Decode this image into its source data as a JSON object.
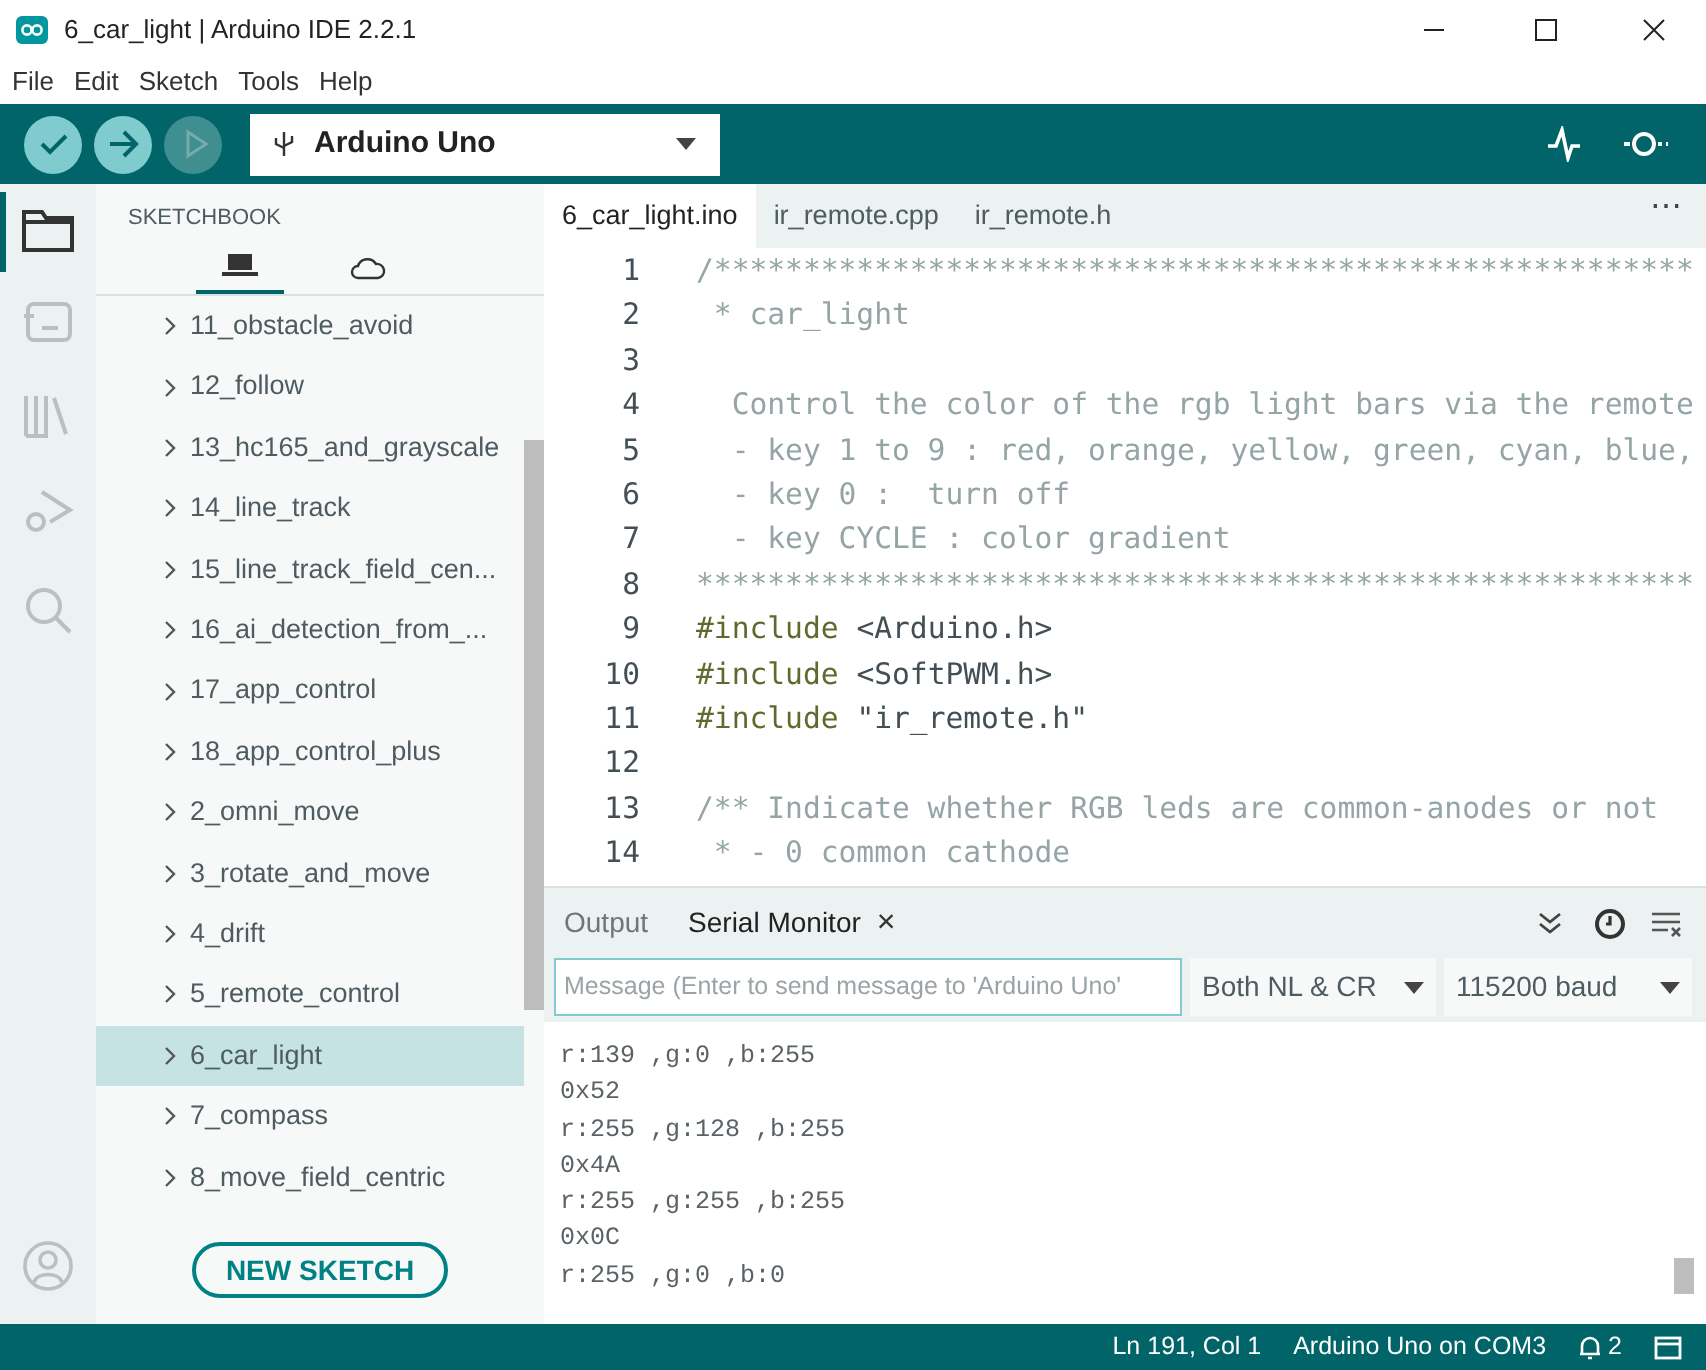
{
  "window": {
    "title": "6_car_light | Arduino IDE 2.2.1"
  },
  "menu": [
    "File",
    "Edit",
    "Sketch",
    "Tools",
    "Help"
  ],
  "toolbar": {
    "board": "Arduino Uno"
  },
  "sidebar": {
    "title": "SKETCHBOOK",
    "tabs": [
      {
        "kind": "local",
        "selected": true
      },
      {
        "kind": "cloud",
        "selected": false
      }
    ],
    "items": [
      {
        "label": "11_obstacle_avoid",
        "selected": false
      },
      {
        "label": "12_follow",
        "selected": false
      },
      {
        "label": "13_hc165_and_grayscale",
        "selected": false
      },
      {
        "label": "14_line_track",
        "selected": false
      },
      {
        "label": "15_line_track_field_cen...",
        "selected": false
      },
      {
        "label": "16_ai_detection_from_...",
        "selected": false
      },
      {
        "label": "17_app_control",
        "selected": false
      },
      {
        "label": "18_app_control_plus",
        "selected": false
      },
      {
        "label": "2_omni_move",
        "selected": false
      },
      {
        "label": "3_rotate_and_move",
        "selected": false
      },
      {
        "label": "4_drift",
        "selected": false
      },
      {
        "label": "5_remote_control",
        "selected": false
      },
      {
        "label": "6_car_light",
        "selected": true
      },
      {
        "label": "7_compass",
        "selected": false
      },
      {
        "label": "8_move_field_centric",
        "selected": false
      }
    ],
    "button": "NEW SKETCH"
  },
  "editor": {
    "more": "⋯",
    "tabs": [
      {
        "label": "6_car_light.ino",
        "selected": true
      },
      {
        "label": "ir_remote.cpp",
        "selected": false
      },
      {
        "label": "ir_remote.h",
        "selected": false
      }
    ],
    "lines": [
      {
        "number": "1",
        "segments": [
          {
            "text": "/*******************************************************",
            "kind": "comment"
          }
        ]
      },
      {
        "number": "2",
        "segments": [
          {
            "text": " * car_light",
            "kind": "comment"
          }
        ]
      },
      {
        "number": "3"
      },
      {
        "number": "4",
        "segments": [
          {
            "text": "  Control the color of the rgb light bars via the remote",
            "kind": "comment"
          }
        ]
      },
      {
        "number": "5",
        "segments": [
          {
            "text": "  - key 1 to 9 : red, orange, yellow, green, cyan, blue,",
            "kind": "comment"
          }
        ]
      },
      {
        "number": "6",
        "segments": [
          {
            "text": "  - key 0 :  turn off",
            "kind": "comment"
          }
        ]
      },
      {
        "number": "7",
        "segments": [
          {
            "text": "  - key CYCLE : color gradient",
            "kind": "comment"
          }
        ]
      },
      {
        "number": "8",
        "segments": [
          {
            "text": "********************************************************",
            "kind": "comment"
          }
        ]
      },
      {
        "number": "9",
        "segments": [
          {
            "text": "#include",
            "kind": "directive"
          },
          {
            "text": " <Arduino.h>",
            "kind": "code"
          }
        ]
      },
      {
        "number": "10",
        "segments": [
          {
            "text": "#include",
            "kind": "directive"
          },
          {
            "text": " <SoftPWM.h>",
            "kind": "code"
          }
        ]
      },
      {
        "number": "11",
        "segments": [
          {
            "text": "#include",
            "kind": "directive"
          },
          {
            "text": " \"ir_remote.h\"",
            "kind": "code"
          }
        ]
      },
      {
        "number": "12"
      },
      {
        "number": "13",
        "segments": [
          {
            "text": "/** Indicate whether RGB leds are common-anodes or not",
            "kind": "comment"
          }
        ]
      },
      {
        "number": "14",
        "segments": [
          {
            "text": " * - 0 common cathode",
            "kind": "comment"
          }
        ]
      }
    ]
  },
  "panel": {
    "tabs": [
      {
        "label": "Output",
        "selected": false
      },
      {
        "label": "Serial Monitor",
        "selected": true,
        "close": "×"
      }
    ],
    "message": {
      "placeholder": "Message (Enter to send message to 'Arduino Uno'"
    },
    "line_ending": "Both NL & CR",
    "baud": "115200 baud",
    "output": [
      "r:139 ,g:0 ,b:255",
      "0x52",
      "r:255 ,g:128 ,b:255",
      "0x4A",
      "r:255 ,g:255 ,b:255",
      "0x0C",
      "r:255 ,g:0 ,b:0"
    ]
  },
  "status_bar": {
    "position": "Ln 191, Col 1",
    "board": "Arduino Uno on COM3",
    "notifications": "2"
  }
}
